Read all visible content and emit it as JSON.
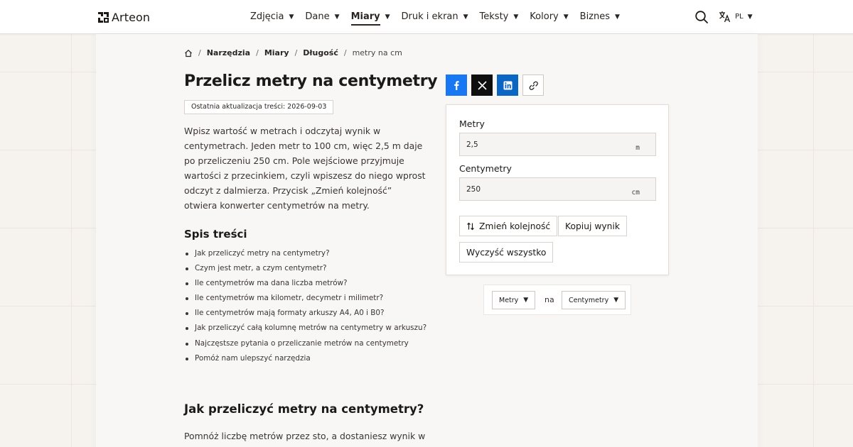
{
  "header": {
    "logo_text": "Arteon",
    "nav": [
      {
        "label": "Zdjęcia",
        "active": false
      },
      {
        "label": "Dane",
        "active": false
      },
      {
        "label": "Miary",
        "active": true
      },
      {
        "label": "Druk i ekran",
        "active": false
      },
      {
        "label": "Teksty",
        "active": false
      },
      {
        "label": "Kolory",
        "active": false
      },
      {
        "label": "Biznes",
        "active": false
      }
    ],
    "language_code": "PL",
    "search_icon": "search-icon",
    "language_icon": "translate-icon"
  },
  "breadcrumb": {
    "home_icon": "home-icon",
    "items": [
      "Narzędzia",
      "Miary",
      "Długość"
    ],
    "current": "metry na cm"
  },
  "article": {
    "title": "Przelicz metry na centymetry",
    "updated": "Ostatnia aktualizacja treści: 2026-09-03",
    "intro": "Wpisz wartość w metrach i odczytaj wynik w centymetrach. Jeden metr to 100 cm, więc 2,5 m daje po przeliczeniu 250 cm. Pole wejściowe przyjmuje wartości z przecinkiem, czyli wpiszesz do niego wprost odczyt z dalmierza. Przycisk „Zmień kolejność” otwiera konwerter centymetrów na metry.",
    "toc_title": "Spis treści",
    "toc": [
      "Jak przeliczyć metry na centymetry?",
      "Czym jest metr, a czym centymetr?",
      "Ile centymetrów ma dana liczba metrów?",
      "Ile centymetrów ma kilometr, decymetr i milimetr?",
      "Ile centymetrów mają formaty arkuszy A4, A0 i B0?",
      "Jak przeliczyć całą kolumnę metrów na centymetry w arkuszu?",
      "Najczęstsze pytania o przeliczanie metrów na centymetry",
      "Pomóż nam ulepszyć narzędzia"
    ],
    "section_title": "Jak przeliczyć metry na centymetry?",
    "section_body": "Pomnóż liczbę metrów przez sto, a dostaniesz wynik w"
  },
  "share": {
    "icons": [
      "facebook-icon",
      "x-icon",
      "linkedin-icon",
      "link-icon"
    ],
    "colors": {
      "facebook": "#1877f2",
      "x": "#0f0f0f",
      "linkedin": "#0a66c2"
    }
  },
  "converter": {
    "from_label": "Metry",
    "from_value": "2,5",
    "from_unit": "m",
    "to_label": "Centymetry",
    "to_value": "250",
    "to_unit": "cm",
    "swap_label": "Zmień kolejność",
    "copy_label": "Kopiuj wynik",
    "clear_label": "Wyczyść wszystko"
  },
  "selector": {
    "from_unit": "Metry",
    "connector": "na",
    "to_unit": "Centymetry"
  }
}
